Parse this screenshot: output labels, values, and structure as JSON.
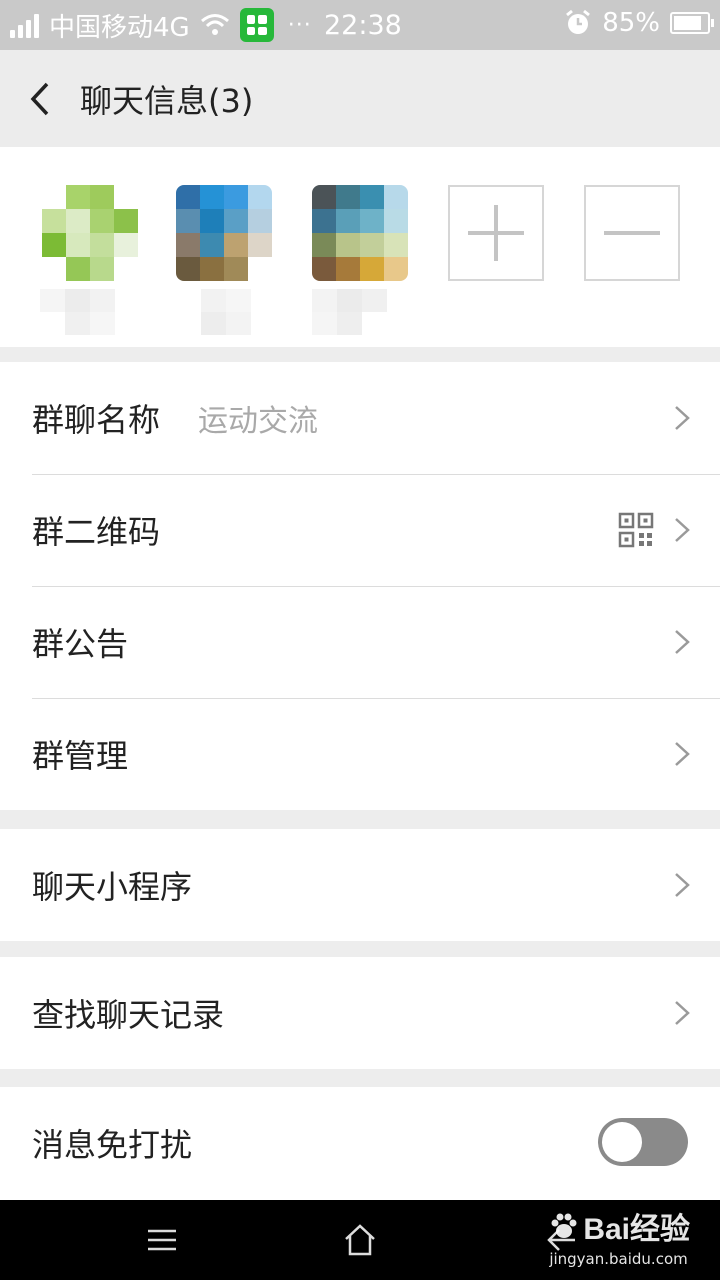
{
  "status_bar": {
    "carrier": "中国移动4G",
    "dots": "···",
    "time": "22:38",
    "battery_percent": "85%",
    "battery_level": 0.85
  },
  "header": {
    "back_icon": "chevron-left-icon",
    "title": "聊天信息(3)"
  },
  "members": {
    "add_icon": "plus-icon",
    "remove_icon": "minus-icon"
  },
  "settings": {
    "group_name_label": "群聊名称",
    "group_name_value": "运动交流",
    "qr_label": "群二维码",
    "announcement_label": "群公告",
    "manage_label": "群管理",
    "mini_programs_label": "聊天小程序",
    "search_history_label": "查找聊天记录",
    "mute_label": "消息免打扰",
    "mute_on": false
  },
  "bottom_bar": {
    "menu_icon": "menu-icon",
    "home_icon": "home-icon",
    "back_icon": "back-icon"
  },
  "watermark": {
    "brand": "Bai经验",
    "url": "jingyan.baidu.com"
  },
  "colors": {
    "status_bar": "#c9c9c9",
    "header": "#ececec",
    "toggle_off": "#8a8a8a",
    "app_icon": "#27b83a"
  }
}
